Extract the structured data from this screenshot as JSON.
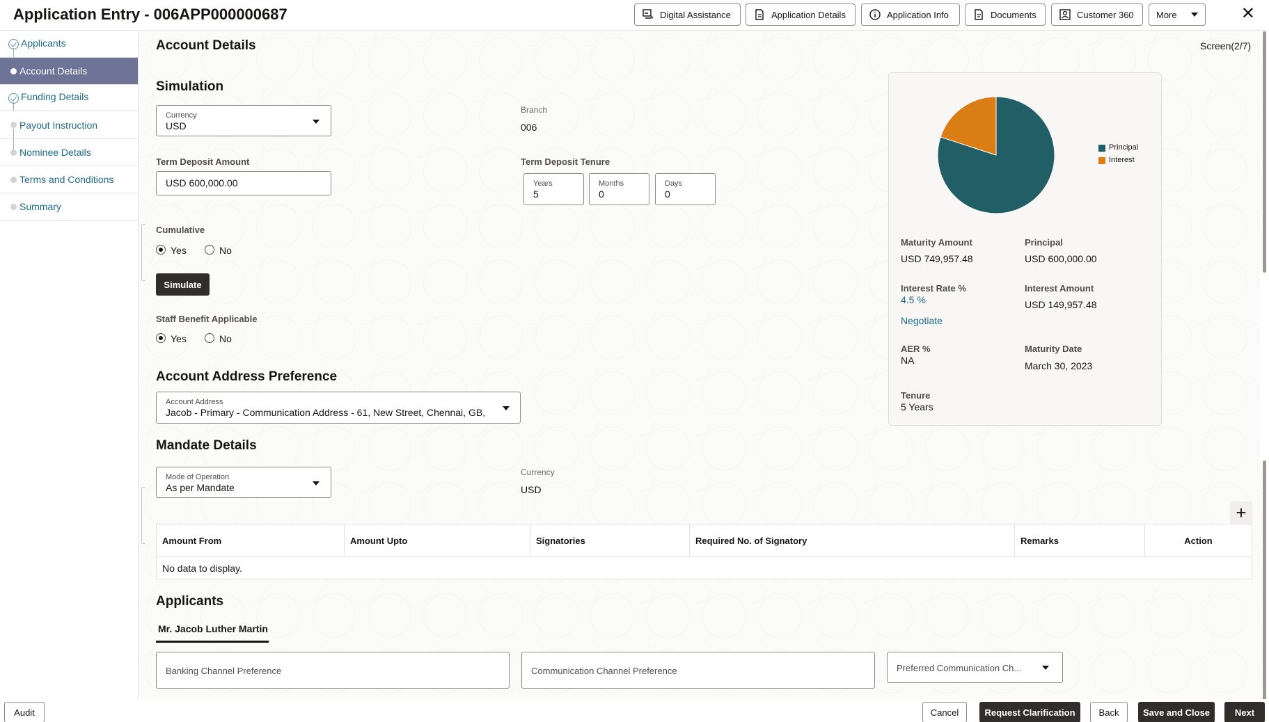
{
  "app": {
    "title": "Application Entry - 006APP000000687",
    "close_icon": "close-icon"
  },
  "header_buttons": [
    {
      "label": "Digital Assistance",
      "icon": "digital-assistant-icon"
    },
    {
      "label": "Application Details",
      "icon": "document-icon"
    },
    {
      "label": "Application Info",
      "icon": "info-icon"
    },
    {
      "label": "Documents",
      "icon": "documents-icon"
    },
    {
      "label": "Customer 360",
      "icon": "customer-icon"
    },
    {
      "label": "More",
      "icon": "chevron-down-icon"
    }
  ],
  "sidebar": {
    "items": [
      {
        "label": "Applicants",
        "state": "completed"
      },
      {
        "label": "Account Details",
        "state": "active"
      },
      {
        "label": "Funding Details",
        "state": "completed"
      },
      {
        "label": "Payout Instruction",
        "state": "pending"
      },
      {
        "label": "Nominee Details",
        "state": "pending"
      },
      {
        "label": "Terms and Conditions",
        "state": "pending"
      },
      {
        "label": "Summary",
        "state": "pending"
      }
    ]
  },
  "page": {
    "title": "Account Details",
    "screen_indicator": "Screen(2/7)"
  },
  "simulation": {
    "title": "Simulation",
    "currency_label": "Currency",
    "currency_value": "USD",
    "branch_label": "Branch",
    "branch_value": "006",
    "amount_label": "Term Deposit Amount",
    "amount_value": "USD 600,000.00",
    "tenure_label": "Term Deposit Tenure",
    "years_label": "Years",
    "years_value": "5",
    "months_label": "Months",
    "months_value": "0",
    "days_label": "Days",
    "days_value": "0",
    "cumulative_label": "Cumulative",
    "yes_label": "Yes",
    "no_label": "No",
    "cumulative_selected": "Yes",
    "simulate_label": "Simulate",
    "staff_label": "Staff Benefit Applicable",
    "staff_selected": "Yes"
  },
  "summary": {
    "legend_principal": "Principal",
    "legend_interest": "Interest",
    "principal_color": "#215e66",
    "interest_color": "#d97d14",
    "principal_share": 0.8,
    "interest_share": 0.2,
    "maturity_amount_label": "Maturity Amount",
    "maturity_amount_value": "USD 749,957.48",
    "principal_label": "Principal",
    "principal_value": "USD 600,000.00",
    "interest_rate_label": "Interest Rate %",
    "interest_rate_value": "4.5 %",
    "interest_amount_label": "Interest Amount",
    "interest_amount_value": "USD 149,957.48",
    "negotiate_label": "Negotiate",
    "aer_label": "AER %",
    "aer_value": "NA",
    "maturity_date_label": "Maturity Date",
    "maturity_date_value": "March 30, 2023",
    "tenure_label": "Tenure",
    "tenure_value": "5 Years"
  },
  "address": {
    "title": "Account Address Preference",
    "label": "Account Address",
    "value": "Jacob - Primary - Communication Address - 61, New Street, Chennai, GB,"
  },
  "mandate": {
    "title": "Mandate Details",
    "mode_label": "Mode of Operation",
    "mode_value": "As per Mandate",
    "currency_label": "Currency",
    "currency_value": "USD",
    "columns": [
      "Amount From",
      "Amount Upto",
      "Signatories",
      "Required No. of Signatory",
      "Remarks",
      "Action"
    ],
    "empty_text": "No data to display."
  },
  "applicants": {
    "title": "Applicants",
    "tab_label": "Mr. Jacob Luther Martin",
    "banking_placeholder": "Banking Channel Preference",
    "communication_placeholder": "Communication Channel Preference",
    "preferred_placeholder": "Preferred Communication Ch..."
  },
  "footer": {
    "audit": "Audit",
    "cancel": "Cancel",
    "request_clarification": "Request Clarification",
    "back": "Back",
    "save_close": "Save and Close",
    "next": "Next"
  }
}
